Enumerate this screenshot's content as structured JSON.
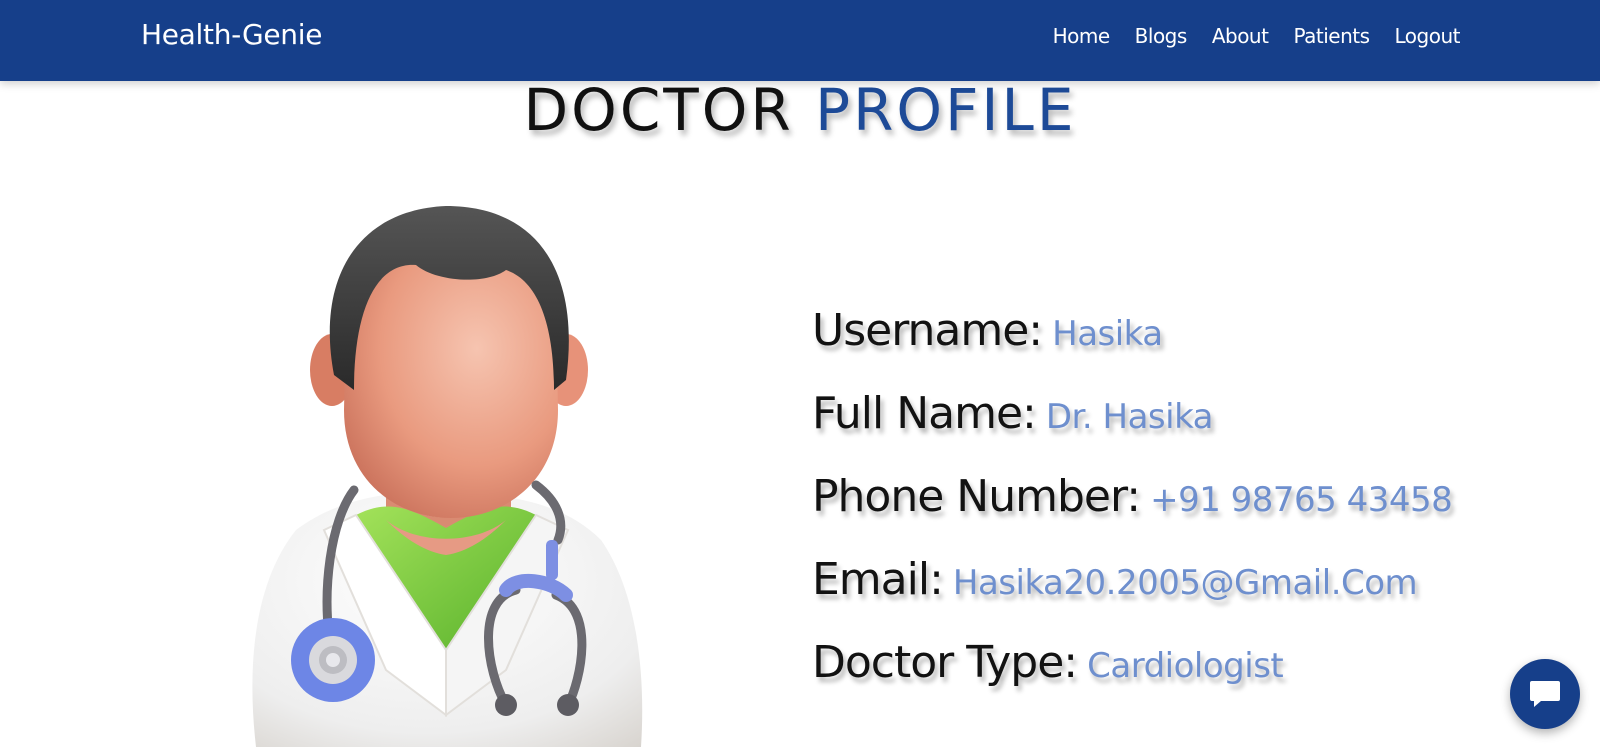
{
  "navbar": {
    "brand": "Health-Genie",
    "links": [
      "Home",
      "Blogs",
      "About",
      "Patients",
      "Logout"
    ]
  },
  "page": {
    "title_part1": "DOCTOR",
    "title_part2": "PROFILE"
  },
  "profile": {
    "username_label": "Username:",
    "username": "Hasika",
    "fullname_label": "Full Name:",
    "fullname": "Dr. Hasika",
    "phone_label": "Phone Number:",
    "phone": "+91 98765 43458",
    "email_label": "Email:",
    "email": "Hasika20.2005@Gmail.Com",
    "type_label": "Doctor Type:",
    "type": "Cardiologist"
  },
  "icons": {
    "chat": "chat-bubble-icon",
    "avatar": "doctor-avatar-illustration"
  },
  "colors": {
    "navbar": "#163f8a",
    "title_accent": "#1d4a97",
    "value_text": "#6e8fce",
    "label_text": "#121212"
  }
}
